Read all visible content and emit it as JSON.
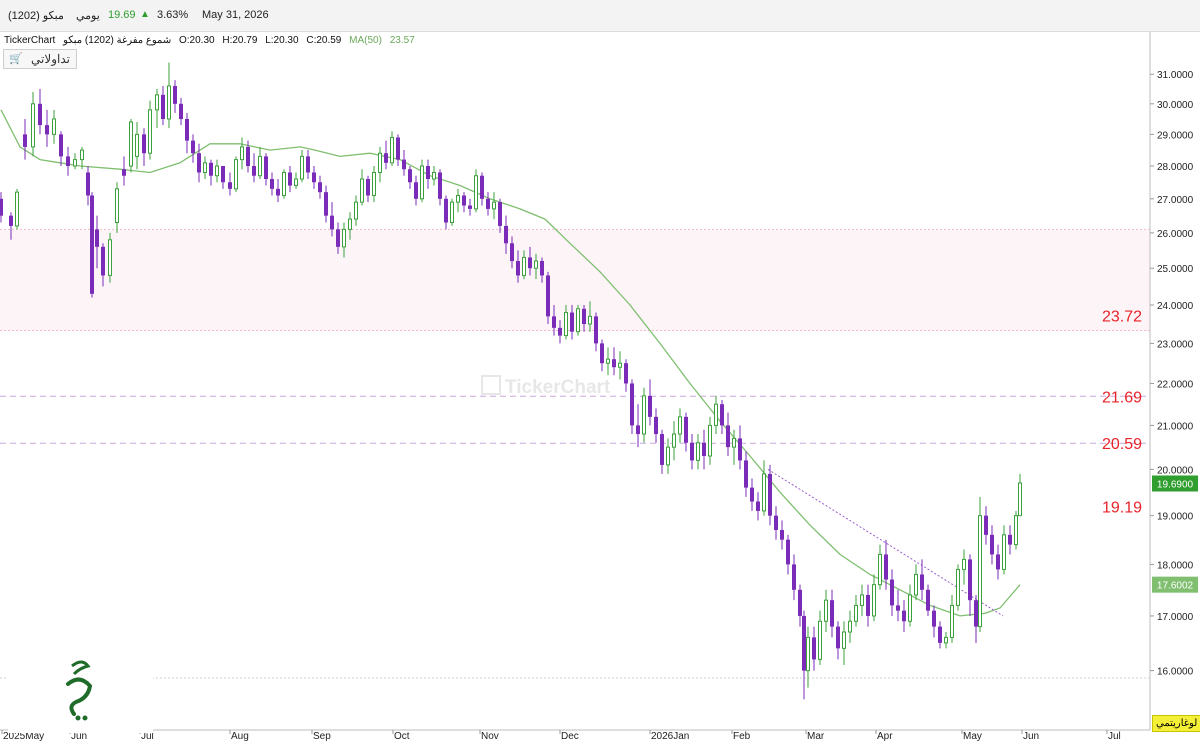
{
  "header": {
    "symbol": "مبكو (1202)",
    "period": "يومي",
    "price": "19.69",
    "change_pct": "3.63%",
    "date": "May 31, 2026"
  },
  "info": {
    "source": "TickerChart",
    "series_label": "شموع مفرغة (1202) مبكو",
    "open": "O:20.30",
    "high": "H:20.79",
    "low": "L:20.30",
    "close": "C:20.59",
    "ma_label": "MA(50)",
    "ma_value": "23.57"
  },
  "brand_button": {
    "label": "تداولاتي",
    "icon": "cart-icon"
  },
  "watermark": "TickerChart",
  "scale_badge": "لوغاريتمي",
  "colors": {
    "up": "#3ca13c",
    "down": "#7a2bb8",
    "ma": "#7fbf6f",
    "level": "#e8232a",
    "accent_green": "#2f9e2f"
  },
  "chart_data": {
    "type": "candlestick",
    "y_scale": "log",
    "ylim": [
      15.35,
      32.2
    ],
    "y_ticks": [
      "16.0000",
      "17.0000",
      "18.0000",
      "19.0000",
      "20.0000",
      "21.0000",
      "22.0000",
      "23.0000",
      "24.0000",
      "25.0000",
      "26.0000",
      "27.0000",
      "28.0000",
      "29.0000",
      "30.0000",
      "31.0000"
    ],
    "x_labels": [
      "2025May",
      "Jun",
      "Jul",
      "Aug",
      "Sep",
      "Oct",
      "Nov",
      "Dec",
      "2026Jan",
      "Feb",
      "Mar",
      "Apr",
      "May",
      "Jun",
      "Jul"
    ],
    "levels": [
      {
        "value": 23.72,
        "label": "23.72",
        "line": 23.33,
        "style": "dotted-pink"
      },
      {
        "value": 21.69,
        "label": "21.69",
        "line": 21.69,
        "style": "dashed-purple"
      },
      {
        "value": 20.59,
        "label": "20.59",
        "line": 20.59,
        "style": "dashed-purple"
      },
      {
        "value": 19.19,
        "label": "19.19",
        "line": null,
        "style": "label-only"
      },
      {
        "value": 26.1,
        "label": "",
        "line": 26.1,
        "style": "dotted-pink"
      },
      {
        "value": 15.87,
        "label": "",
        "line": 15.87,
        "style": "dotted-gray"
      }
    ],
    "price_tags": [
      {
        "value": 19.69,
        "label": "19.6900"
      },
      {
        "value": 17.6002,
        "label": "17.6002"
      }
    ],
    "ma50": [
      [
        1,
        29.8
      ],
      [
        20,
        28.6
      ],
      [
        40,
        28.2
      ],
      [
        60,
        28.1
      ],
      [
        80,
        28.0
      ],
      [
        120,
        27.9
      ],
      [
        150,
        27.8
      ],
      [
        180,
        28.1
      ],
      [
        210,
        28.7
      ],
      [
        240,
        28.7
      ],
      [
        270,
        28.5
      ],
      [
        300,
        28.6
      ],
      [
        315,
        28.5
      ],
      [
        340,
        28.3
      ],
      [
        370,
        28.4
      ],
      [
        400,
        28.2
      ],
      [
        430,
        27.7
      ],
      [
        460,
        27.4
      ],
      [
        490,
        27.0
      ],
      [
        520,
        26.7
      ],
      [
        545,
        26.4
      ],
      [
        570,
        25.7
      ],
      [
        600,
        24.9
      ],
      [
        630,
        24.0
      ],
      [
        660,
        23.0
      ],
      [
        690,
        22.0
      ],
      [
        720,
        21.1
      ],
      [
        750,
        20.3
      ],
      [
        780,
        19.5
      ],
      [
        810,
        18.8
      ],
      [
        840,
        18.2
      ],
      [
        870,
        17.8
      ],
      [
        900,
        17.5
      ],
      [
        930,
        17.2
      ],
      [
        960,
        17.0
      ],
      [
        985,
        17.05
      ],
      [
        1000,
        17.15
      ],
      [
        1020,
        17.6
      ]
    ],
    "trendline": [
      [
        768,
        20.0
      ],
      [
        1003,
        17.0
      ]
    ],
    "candles": [
      [
        1,
        27.0,
        27.2,
        26.3,
        26.5
      ],
      [
        11,
        26.5,
        26.6,
        25.8,
        26.2
      ],
      [
        17,
        26.2,
        27.3,
        26.1,
        27.2
      ],
      [
        25,
        29.0,
        29.5,
        28.2,
        28.6
      ],
      [
        33,
        28.6,
        30.4,
        28.3,
        30.0
      ],
      [
        40,
        30.0,
        30.5,
        29.0,
        29.3
      ],
      [
        47,
        29.3,
        29.8,
        28.6,
        29.0
      ],
      [
        54,
        29.0,
        29.8,
        28.7,
        29.5
      ],
      [
        61,
        29.0,
        29.1,
        28.0,
        28.3
      ],
      [
        68,
        28.3,
        28.6,
        27.7,
        28.0
      ],
      [
        75,
        28.0,
        28.4,
        27.9,
        28.2
      ],
      [
        82,
        28.2,
        28.6,
        27.9,
        28.5
      ],
      [
        88,
        27.8,
        28.0,
        26.8,
        27.1
      ],
      [
        92,
        27.1,
        27.2,
        24.2,
        24.3
      ],
      [
        97,
        26.1,
        26.5,
        25.0,
        25.6
      ],
      [
        103,
        25.6,
        25.7,
        24.5,
        24.8
      ],
      [
        110,
        24.8,
        26.0,
        24.6,
        25.8
      ],
      [
        117,
        26.3,
        27.5,
        26.0,
        27.3
      ],
      [
        124,
        27.9,
        28.3,
        27.4,
        27.7
      ],
      [
        131,
        28.0,
        29.5,
        27.8,
        29.4
      ],
      [
        137,
        28.3,
        29.4,
        27.9,
        29.0
      ],
      [
        144,
        29.0,
        29.2,
        28.0,
        28.4
      ],
      [
        150,
        28.4,
        30.1,
        28.2,
        29.8
      ],
      [
        157,
        29.8,
        30.5,
        29.2,
        30.3
      ],
      [
        163,
        30.3,
        30.6,
        29.3,
        29.5
      ],
      [
        169,
        29.5,
        31.4,
        29.2,
        30.6
      ],
      [
        175,
        30.6,
        30.8,
        29.7,
        30.0
      ],
      [
        181,
        30.0,
        30.2,
        29.3,
        29.5
      ],
      [
        187,
        29.5,
        29.7,
        28.4,
        28.8
      ],
      [
        193,
        28.8,
        29.0,
        28.1,
        28.4
      ],
      [
        199,
        28.4,
        28.7,
        27.5,
        27.8
      ],
      [
        205,
        27.8,
        28.3,
        27.6,
        28.1
      ],
      [
        211,
        28.1,
        28.2,
        27.4,
        27.7
      ],
      [
        217,
        27.7,
        28.2,
        27.5,
        28.0
      ],
      [
        223,
        28.0,
        28.0,
        27.3,
        27.5
      ],
      [
        230,
        27.5,
        27.8,
        27.1,
        27.3
      ],
      [
        236,
        27.3,
        28.3,
        27.2,
        28.2
      ],
      [
        242,
        28.2,
        28.9,
        27.9,
        28.6
      ],
      [
        248,
        28.6,
        28.8,
        27.8,
        28.0
      ],
      [
        254,
        28.0,
        28.4,
        27.5,
        27.7
      ],
      [
        260,
        27.7,
        28.6,
        27.6,
        28.3
      ],
      [
        266,
        28.3,
        28.4,
        27.4,
        27.6
      ],
      [
        272,
        27.6,
        27.8,
        27.1,
        27.3
      ],
      [
        278,
        27.3,
        27.6,
        26.9,
        27.1
      ],
      [
        284,
        27.1,
        27.9,
        27.0,
        27.8
      ],
      [
        290,
        27.8,
        28.0,
        27.2,
        27.4
      ],
      [
        296,
        27.4,
        27.8,
        27.3,
        27.6
      ],
      [
        302,
        27.6,
        28.5,
        27.5,
        28.3
      ],
      [
        308,
        28.3,
        28.5,
        27.6,
        27.8
      ],
      [
        314,
        27.8,
        28.0,
        27.3,
        27.5
      ],
      [
        320,
        27.5,
        27.7,
        27.0,
        27.2
      ],
      [
        326,
        27.2,
        27.4,
        26.3,
        26.5
      ],
      [
        332,
        26.5,
        26.9,
        25.9,
        26.1
      ],
      [
        338,
        26.1,
        26.3,
        25.4,
        25.6
      ],
      [
        344,
        25.6,
        26.3,
        25.3,
        26.1
      ],
      [
        350,
        26.1,
        26.6,
        25.8,
        26.4
      ],
      [
        356,
        26.4,
        27.1,
        26.2,
        26.9
      ],
      [
        362,
        26.9,
        27.9,
        26.8,
        27.6
      ],
      [
        368,
        27.6,
        27.7,
        26.9,
        27.1
      ],
      [
        374,
        27.1,
        28.0,
        26.9,
        27.8
      ],
      [
        380,
        27.8,
        28.6,
        27.5,
        28.4
      ],
      [
        386,
        28.4,
        28.8,
        27.9,
        28.1
      ],
      [
        392,
        28.1,
        29.1,
        28.0,
        28.9
      ],
      [
        398,
        28.9,
        29.0,
        28.0,
        28.2
      ],
      [
        404,
        28.2,
        28.5,
        27.7,
        27.9
      ],
      [
        410,
        27.9,
        28.0,
        27.3,
        27.5
      ],
      [
        416,
        27.5,
        27.7,
        26.8,
        27.0
      ],
      [
        422,
        27.0,
        28.2,
        26.9,
        28.0
      ],
      [
        428,
        28.0,
        28.2,
        27.3,
        27.6
      ],
      [
        434,
        27.6,
        28.0,
        27.4,
        27.8
      ],
      [
        440,
        27.8,
        27.9,
        26.8,
        27.0
      ],
      [
        446,
        27.0,
        27.1,
        26.1,
        26.3
      ],
      [
        452,
        26.3,
        27.0,
        26.2,
        26.9
      ],
      [
        458,
        26.9,
        27.3,
        26.6,
        27.1
      ],
      [
        464,
        27.1,
        27.2,
        26.6,
        26.8
      ],
      [
        470,
        26.8,
        27.0,
        26.5,
        26.7
      ],
      [
        476,
        26.7,
        27.9,
        26.6,
        27.7
      ],
      [
        482,
        27.7,
        27.8,
        26.8,
        27.0
      ],
      [
        488,
        27.0,
        27.2,
        26.5,
        26.7
      ],
      [
        494,
        26.7,
        27.2,
        26.4,
        26.9
      ],
      [
        500,
        26.9,
        27.0,
        26.0,
        26.2
      ],
      [
        506,
        26.2,
        26.5,
        25.4,
        25.7
      ],
      [
        512,
        25.7,
        25.9,
        25.0,
        25.2
      ],
      [
        518,
        25.2,
        25.5,
        24.6,
        24.8
      ],
      [
        524,
        24.8,
        25.5,
        24.7,
        25.3
      ],
      [
        530,
        25.3,
        25.6,
        24.8,
        25.0
      ],
      [
        536,
        25.0,
        25.4,
        24.7,
        25.2
      ],
      [
        542,
        25.2,
        25.3,
        24.6,
        24.8
      ],
      [
        548,
        24.8,
        24.9,
        23.5,
        23.7
      ],
      [
        554,
        23.7,
        24.0,
        23.2,
        23.4
      ],
      [
        560,
        23.4,
        23.6,
        23.0,
        23.2
      ],
      [
        566,
        23.2,
        24.0,
        23.1,
        23.8
      ],
      [
        572,
        23.8,
        24.0,
        23.1,
        23.3
      ],
      [
        578,
        23.3,
        24.0,
        23.2,
        23.9
      ],
      [
        584,
        23.9,
        24.0,
        23.3,
        23.5
      ],
      [
        590,
        23.5,
        24.1,
        23.3,
        23.7
      ],
      [
        596,
        23.7,
        23.8,
        22.8,
        23.0
      ],
      [
        602,
        23.0,
        23.1,
        22.3,
        22.5
      ],
      [
        608,
        22.5,
        22.9,
        22.2,
        22.6
      ],
      [
        614,
        22.6,
        22.9,
        22.2,
        22.4
      ],
      [
        620,
        22.4,
        22.8,
        22.1,
        22.5
      ],
      [
        626,
        22.5,
        22.6,
        21.8,
        22.0
      ],
      [
        632,
        22.0,
        22.1,
        20.8,
        21.0
      ],
      [
        638,
        21.0,
        21.5,
        20.5,
        20.8
      ],
      [
        644,
        20.8,
        21.9,
        20.6,
        21.7
      ],
      [
        650,
        21.7,
        22.1,
        21.0,
        21.2
      ],
      [
        656,
        21.2,
        21.4,
        20.6,
        20.8
      ],
      [
        662,
        20.8,
        20.9,
        19.9,
        20.1
      ],
      [
        668,
        20.1,
        20.7,
        19.9,
        20.5
      ],
      [
        674,
        20.5,
        21.1,
        20.2,
        20.8
      ],
      [
        680,
        20.8,
        21.4,
        20.6,
        21.2
      ],
      [
        686,
        21.2,
        21.3,
        20.4,
        20.6
      ],
      [
        692,
        20.6,
        20.8,
        20.0,
        20.2
      ],
      [
        698,
        20.2,
        20.8,
        20.0,
        20.6
      ],
      [
        704,
        20.6,
        20.9,
        20.0,
        20.3
      ],
      [
        710,
        20.3,
        21.2,
        20.1,
        21.0
      ],
      [
        716,
        21.0,
        21.7,
        20.8,
        21.5
      ],
      [
        722,
        21.5,
        21.6,
        20.8,
        21.0
      ],
      [
        728,
        21.0,
        21.3,
        20.3,
        20.5
      ],
      [
        734,
        20.5,
        20.9,
        20.1,
        20.7
      ],
      [
        740,
        20.7,
        21.0,
        20.0,
        20.2
      ],
      [
        746,
        20.2,
        20.4,
        19.4,
        19.6
      ],
      [
        752,
        19.6,
        19.8,
        19.1,
        19.3
      ],
      [
        758,
        19.3,
        19.5,
        18.9,
        19.1
      ],
      [
        764,
        19.1,
        20.2,
        19.0,
        19.9
      ],
      [
        770,
        19.9,
        20.1,
        18.8,
        19.0
      ],
      [
        776,
        19.0,
        19.2,
        18.5,
        18.7
      ],
      [
        782,
        18.7,
        18.9,
        18.3,
        18.5
      ],
      [
        788,
        18.5,
        18.6,
        17.8,
        18.0
      ],
      [
        794,
        18.0,
        18.2,
        17.3,
        17.5
      ],
      [
        800,
        17.5,
        17.6,
        16.8,
        17.0
      ],
      [
        804,
        17.0,
        17.1,
        15.5,
        16.0
      ],
      [
        808,
        16.0,
        16.8,
        15.7,
        16.6
      ],
      [
        814,
        16.6,
        16.8,
        16.0,
        16.2
      ],
      [
        820,
        16.2,
        17.1,
        16.1,
        16.9
      ],
      [
        826,
        16.9,
        17.5,
        16.7,
        17.3
      ],
      [
        832,
        17.3,
        17.5,
        16.6,
        16.8
      ],
      [
        838,
        16.8,
        16.9,
        16.2,
        16.4
      ],
      [
        844,
        16.4,
        16.9,
        16.1,
        16.7
      ],
      [
        850,
        16.7,
        17.1,
        16.5,
        16.9
      ],
      [
        856,
        16.9,
        17.4,
        16.8,
        17.2
      ],
      [
        862,
        17.2,
        17.6,
        17.0,
        17.4
      ],
      [
        868,
        17.4,
        17.6,
        16.8,
        17.0
      ],
      [
        874,
        17.0,
        17.8,
        16.9,
        17.6
      ],
      [
        880,
        17.6,
        18.4,
        17.5,
        18.2
      ],
      [
        886,
        18.2,
        18.5,
        17.5,
        17.7
      ],
      [
        892,
        17.7,
        17.9,
        17.0,
        17.2
      ],
      [
        898,
        17.2,
        17.5,
        16.9,
        17.1
      ],
      [
        904,
        17.1,
        17.3,
        16.7,
        16.9
      ],
      [
        910,
        16.9,
        17.6,
        16.8,
        17.4
      ],
      [
        916,
        17.4,
        18.0,
        17.3,
        17.8
      ],
      [
        922,
        17.8,
        18.1,
        17.3,
        17.5
      ],
      [
        928,
        17.5,
        17.6,
        17.0,
        17.1
      ],
      [
        934,
        17.1,
        17.2,
        16.6,
        16.8
      ],
      [
        940,
        16.8,
        16.9,
        16.4,
        16.5
      ],
      [
        946,
        16.5,
        16.7,
        16.4,
        16.6
      ],
      [
        952,
        16.6,
        17.4,
        16.5,
        17.2
      ],
      [
        958,
        17.2,
        18.0,
        17.1,
        17.9
      ],
      [
        964,
        17.9,
        18.3,
        17.6,
        18.1
      ],
      [
        970,
        18.1,
        18.2,
        17.0,
        17.3
      ],
      [
        976,
        17.3,
        17.4,
        16.5,
        16.8
      ],
      [
        980,
        16.8,
        19.4,
        16.7,
        19.0
      ],
      [
        986,
        19.0,
        19.2,
        18.4,
        18.6
      ],
      [
        992,
        18.6,
        18.8,
        18.0,
        18.2
      ],
      [
        998,
        18.2,
        18.4,
        17.7,
        17.9
      ],
      [
        1004,
        17.9,
        18.8,
        17.8,
        18.6
      ],
      [
        1010,
        18.6,
        18.8,
        18.2,
        18.4
      ],
      [
        1016,
        18.4,
        19.1,
        18.3,
        19.0
      ],
      [
        1020,
        19.0,
        19.9,
        19.0,
        19.7
      ]
    ]
  }
}
